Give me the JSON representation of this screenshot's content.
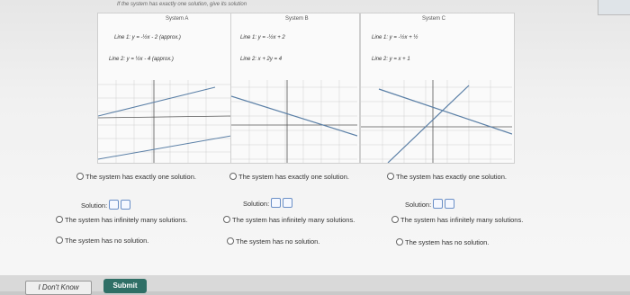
{
  "instruction": "If the system has exactly one solution, give its solution",
  "systems": [
    {
      "title": "System A",
      "line1": "Line 1: y = -½x - 2 (approx.)",
      "line2": "Line 2: y = ½x - 4 (approx.)",
      "options": [
        "The system has exactly one solution.",
        "The system has infinitely many solutions.",
        "The system has no solution."
      ],
      "solution_label": "Solution:"
    },
    {
      "title": "System B",
      "line1": "Line 1: y = -½x + 2",
      "line2": "Line 2: x + 2y = 4",
      "options": [
        "The system has exactly one solution.",
        "The system has infinitely many solutions.",
        "The system has no solution."
      ],
      "solution_label": "Solution:"
    },
    {
      "title": "System C",
      "line1": "Line 1: y = -½x + ½",
      "line2": "Line 2: y = x + 1",
      "options": [
        "The system has exactly one solution.",
        "The system has infinitely many solutions.",
        "The system has no solution."
      ],
      "solution_label": "Solution:"
    }
  ],
  "buttons": {
    "dont_know": "I Don't Know",
    "submit": "Submit"
  },
  "colors": {
    "submit_bg": "#2f6f66",
    "line_color": "#5a7fa6"
  }
}
